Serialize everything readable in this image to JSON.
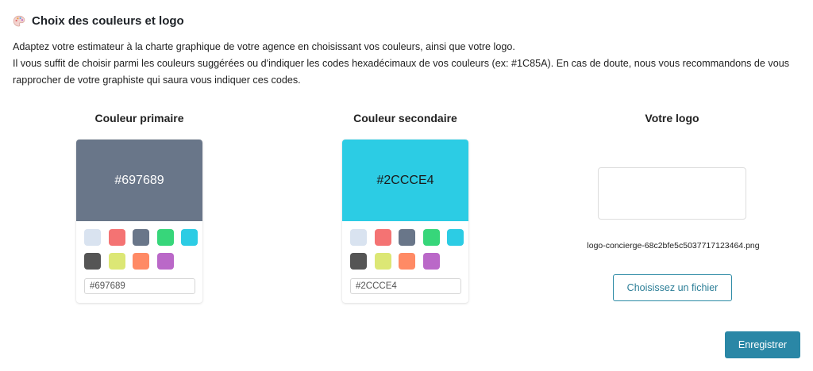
{
  "section": {
    "icon": "palette-icon",
    "title": "Choix des couleurs et logo"
  },
  "intro": {
    "line1": "Adaptez votre estimateur à la charte graphique de votre agence en choisissant vos couleurs, ainsi que votre logo.",
    "line2": "Il vous suffit de choisir parmi les couleurs suggérées ou d'indiquer les codes hexadécimaux de vos couleurs (ex: #1C85A). En cas de doute, nous vous recommandons de vous rapprocher de votre graphiste qui saura vous indiquer ces codes."
  },
  "primary": {
    "title": "Couleur primaire",
    "value": "#697689",
    "preview_color": "#697689",
    "preview_text_color": "#ffffff",
    "input_value": "#697689"
  },
  "secondary": {
    "title": "Couleur secondaire",
    "value": "#2CCCE4",
    "preview_color": "#2CCCE4",
    "preview_text_color": "#1a1a1a",
    "input_value": "#2CCCE4"
  },
  "suggested_colors": [
    "#D9E3F0",
    "#F47373",
    "#697689",
    "#37D67A",
    "#2CCCE4",
    "#555555",
    "#DCE775",
    "#FF8A65",
    "#BA68C8"
  ],
  "logo": {
    "title": "Votre logo",
    "filename": "logo-concierge-68c2bfe5c5037717123464.png",
    "choose_label": "Choisissez un fichier"
  },
  "save_label": "Enregistrer"
}
